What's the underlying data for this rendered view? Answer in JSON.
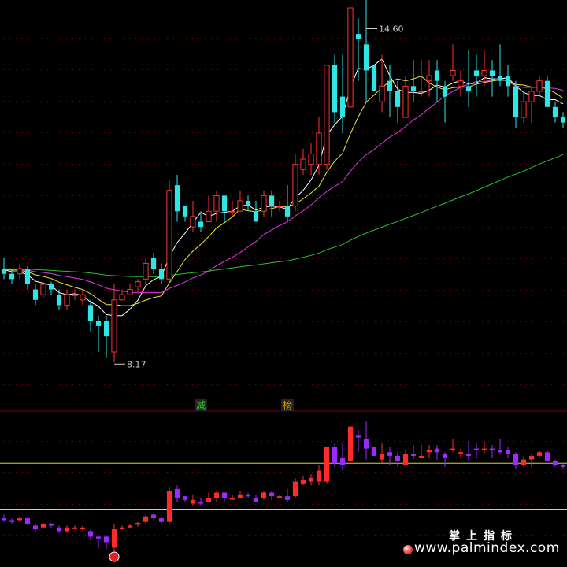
{
  "chart_data": {
    "type": "candlestick",
    "main_panel": {
      "ylim": [
        7.6,
        15.0
      ],
      "high_annotation": "14.60",
      "low_annotation": "8.17",
      "high_value": 14.6,
      "low_value": 8.17,
      "candles": [
        [
          10.0,
          9.9,
          10.2,
          9.8
        ],
        [
          9.9,
          9.8,
          10.0,
          9.7
        ],
        [
          9.9,
          10.0,
          10.1,
          9.8
        ],
        [
          10.0,
          9.7,
          10.05,
          9.6
        ],
        [
          9.6,
          9.4,
          9.7,
          9.3
        ],
        [
          9.5,
          9.7,
          9.75,
          9.45
        ],
        [
          9.7,
          9.6,
          9.75,
          9.5
        ],
        [
          9.5,
          9.3,
          9.6,
          9.2
        ],
        [
          9.3,
          9.5,
          9.6,
          9.2
        ],
        [
          9.5,
          9.5,
          9.6,
          9.4
        ],
        [
          9.4,
          9.5,
          9.6,
          9.3
        ],
        [
          9.3,
          9.0,
          9.4,
          8.8
        ],
        [
          9.0,
          8.9,
          9.1,
          8.4
        ],
        [
          9.0,
          8.7,
          9.1,
          8.3
        ],
        [
          8.4,
          9.4,
          9.7,
          8.2
        ],
        [
          9.4,
          9.5,
          9.6,
          9.4
        ],
        [
          9.5,
          9.6,
          9.7,
          9.5
        ],
        [
          9.65,
          9.75,
          9.8,
          9.55
        ],
        [
          9.8,
          10.1,
          10.2,
          9.7
        ],
        [
          10.2,
          10.0,
          10.3,
          9.9
        ],
        [
          10.0,
          9.8,
          10.1,
          9.7
        ],
        [
          9.8,
          11.5,
          11.7,
          9.7
        ],
        [
          11.6,
          11.1,
          11.8,
          10.9
        ],
        [
          11.2,
          11.0,
          11.2,
          10.9
        ],
        [
          10.8,
          11.0,
          11.3,
          10.7
        ],
        [
          10.9,
          10.8,
          11.1,
          10.7
        ],
        [
          10.9,
          11.1,
          11.4,
          10.9
        ],
        [
          11.1,
          11.4,
          11.5,
          10.9
        ],
        [
          11.4,
          11.1,
          11.4,
          10.9
        ],
        [
          11.1,
          11.1,
          11.3,
          11.0
        ],
        [
          11.1,
          11.3,
          11.5,
          11.1
        ],
        [
          11.3,
          11.2,
          11.4,
          11.1
        ],
        [
          11.1,
          10.9,
          11.3,
          10.9
        ],
        [
          11.1,
          11.4,
          11.5,
          11.0
        ],
        [
          11.4,
          11.2,
          11.5,
          11.0
        ],
        [
          11.2,
          11.2,
          11.3,
          11.1
        ],
        [
          11.2,
          11.0,
          11.6,
          10.9
        ],
        [
          11.2,
          12.0,
          12.2,
          11.1
        ],
        [
          11.9,
          12.1,
          12.3,
          11.8
        ],
        [
          12.0,
          12.2,
          12.4,
          11.8
        ],
        [
          12.0,
          12.6,
          12.9,
          11.8
        ],
        [
          12.0,
          13.9,
          13.9,
          11.9
        ],
        [
          13.9,
          13.0,
          14.1,
          12.8
        ],
        [
          13.3,
          12.9,
          14.1,
          12.6
        ],
        [
          13.1,
          15.0,
          15.0,
          13.1
        ],
        [
          14.5,
          14.4,
          14.8,
          13.6
        ],
        [
          14.3,
          13.8,
          15.3,
          13.2
        ],
        [
          13.9,
          13.4,
          13.9,
          13.4
        ],
        [
          13.2,
          13.5,
          14.1,
          13.0
        ],
        [
          13.6,
          13.4,
          13.9,
          12.9
        ],
        [
          13.4,
          13.1,
          13.6,
          12.8
        ],
        [
          12.9,
          13.5,
          13.7,
          12.9
        ],
        [
          13.5,
          13.4,
          14.0,
          13.2
        ],
        [
          13.4,
          13.4,
          14.0,
          13.3
        ],
        [
          13.6,
          13.7,
          14.0,
          13.3
        ],
        [
          13.8,
          13.6,
          14.0,
          13.2
        ],
        [
          13.5,
          13.3,
          13.6,
          12.8
        ],
        [
          13.7,
          13.8,
          14.3,
          13.6
        ],
        [
          13.5,
          13.6,
          13.8,
          13.3
        ],
        [
          13.5,
          13.4,
          14.2,
          13.1
        ],
        [
          13.8,
          13.7,
          14.1,
          13.3
        ],
        [
          13.7,
          13.8,
          14.2,
          13.5
        ],
        [
          13.8,
          13.7,
          14.0,
          13.3
        ],
        [
          13.7,
          13.6,
          14.3,
          13.5
        ],
        [
          13.7,
          13.5,
          13.9,
          13.3
        ],
        [
          13.5,
          12.9,
          13.6,
          12.7
        ],
        [
          12.9,
          13.2,
          13.4,
          12.8
        ],
        [
          13.2,
          13.4,
          13.5,
          12.8
        ],
        [
          13.4,
          13.6,
          13.7,
          13.3
        ],
        [
          13.6,
          13.1,
          13.7,
          13.1
        ],
        [
          13.1,
          12.9,
          13.2,
          12.8
        ],
        [
          12.9,
          12.8,
          13.0,
          12.7
        ]
      ],
      "ma_colors": [
        "#ffffff",
        "#e8e838",
        "#e038e0",
        "#2fbf2f"
      ]
    },
    "indicator_panel": {
      "ylim": [
        -0.6,
        1.1
      ],
      "ref_levels": [
        0.55,
        0.0
      ],
      "ref_colors": [
        "#d8d820",
        "#cccccc"
      ],
      "signal_labels": [
        {
          "label": "减",
          "at": 25,
          "color": "#3c3"
        },
        {
          "label": "榜",
          "at": 36,
          "color": "#dd9900"
        }
      ]
    },
    "colors": {
      "up": "#ff3333",
      "down": "#2ee6e6",
      "ind_up": "#ff2a2a",
      "ind_down": "#9b2bff",
      "grid": "#7a0020"
    }
  },
  "watermark": {
    "cn": "掌上指标",
    "url": "www.palmindex.com"
  }
}
